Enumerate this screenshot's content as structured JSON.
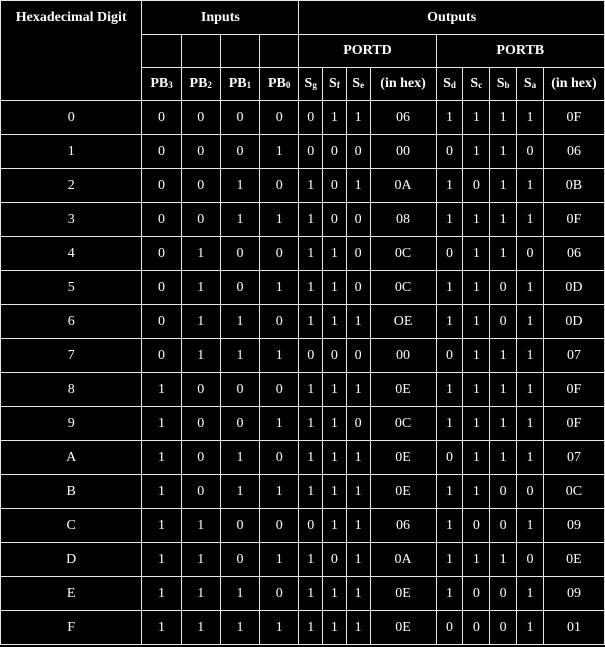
{
  "headers": {
    "hex_digit": "Hexadecimal Digit",
    "inputs": "Inputs",
    "outputs": "Outputs",
    "portd": "PORTD",
    "portb": "PORTB",
    "input_cols": [
      {
        "base": "PB",
        "sub": "3"
      },
      {
        "base": "PB",
        "sub": "2"
      },
      {
        "base": "PB",
        "sub": "1"
      },
      {
        "base": "PB",
        "sub": "0"
      }
    ],
    "portd_cols": [
      {
        "base": "S",
        "sub": "g"
      },
      {
        "base": "S",
        "sub": "f"
      },
      {
        "base": "S",
        "sub": "e"
      }
    ],
    "portd_hex": "(in hex)",
    "portb_cols": [
      {
        "base": "S",
        "sub": "d"
      },
      {
        "base": "S",
        "sub": "c"
      },
      {
        "base": "S",
        "sub": "b"
      },
      {
        "base": "S",
        "sub": "a"
      }
    ],
    "portb_hex": "(in hex)"
  },
  "rows": [
    {
      "digit": "0",
      "pb": [
        "0",
        "0",
        "0",
        "0"
      ],
      "d": [
        "0",
        "1",
        "1"
      ],
      "dhex": "06",
      "b": [
        "1",
        "1",
        "1",
        "1"
      ],
      "bhex": "0F"
    },
    {
      "digit": "1",
      "pb": [
        "0",
        "0",
        "0",
        "1"
      ],
      "d": [
        "0",
        "0",
        "0"
      ],
      "dhex": "00",
      "b": [
        "0",
        "1",
        "1",
        "0"
      ],
      "bhex": "06"
    },
    {
      "digit": "2",
      "pb": [
        "0",
        "0",
        "1",
        "0"
      ],
      "d": [
        "1",
        "0",
        "1"
      ],
      "dhex": "0A",
      "b": [
        "1",
        "0",
        "1",
        "1"
      ],
      "bhex": "0B"
    },
    {
      "digit": "3",
      "pb": [
        "0",
        "0",
        "1",
        "1"
      ],
      "d": [
        "1",
        "0",
        "0"
      ],
      "dhex": "08",
      "b": [
        "1",
        "1",
        "1",
        "1"
      ],
      "bhex": "0F"
    },
    {
      "digit": "4",
      "pb": [
        "0",
        "1",
        "0",
        "0"
      ],
      "d": [
        "1",
        "1",
        "0"
      ],
      "dhex": "0C",
      "b": [
        "0",
        "1",
        "1",
        "0"
      ],
      "bhex": "06"
    },
    {
      "digit": "5",
      "pb": [
        "0",
        "1",
        "0",
        "1"
      ],
      "d": [
        "1",
        "1",
        "0"
      ],
      "dhex": "0C",
      "b": [
        "1",
        "1",
        "0",
        "1"
      ],
      "bhex": "0D"
    },
    {
      "digit": "6",
      "pb": [
        "0",
        "1",
        "1",
        "0"
      ],
      "d": [
        "1",
        "1",
        "1"
      ],
      "dhex": "OE",
      "b": [
        "1",
        "1",
        "0",
        "1"
      ],
      "bhex": "0D"
    },
    {
      "digit": "7",
      "pb": [
        "0",
        "1",
        "1",
        "1"
      ],
      "d": [
        "0",
        "0",
        "0"
      ],
      "dhex": "00",
      "b": [
        "0",
        "1",
        "1",
        "1"
      ],
      "bhex": "07"
    },
    {
      "digit": "8",
      "pb": [
        "1",
        "0",
        "0",
        "0"
      ],
      "d": [
        "1",
        "1",
        "1"
      ],
      "dhex": "0E",
      "b": [
        "1",
        "1",
        "1",
        "1"
      ],
      "bhex": "0F"
    },
    {
      "digit": "9",
      "pb": [
        "1",
        "0",
        "0",
        "1"
      ],
      "d": [
        "1",
        "1",
        "0"
      ],
      "dhex": "0C",
      "b": [
        "1",
        "1",
        "1",
        "1"
      ],
      "bhex": "0F"
    },
    {
      "digit": "A",
      "pb": [
        "1",
        "0",
        "1",
        "0"
      ],
      "d": [
        "1",
        "1",
        "1"
      ],
      "dhex": "0E",
      "b": [
        "0",
        "1",
        "1",
        "1"
      ],
      "bhex": "07"
    },
    {
      "digit": "B",
      "pb": [
        "1",
        "0",
        "1",
        "1"
      ],
      "d": [
        "1",
        "1",
        "1"
      ],
      "dhex": "0E",
      "b": [
        "1",
        "1",
        "0",
        "0"
      ],
      "bhex": "0C"
    },
    {
      "digit": "C",
      "pb": [
        "1",
        "1",
        "0",
        "0"
      ],
      "d": [
        "0",
        "1",
        "1"
      ],
      "dhex": "06",
      "b": [
        "1",
        "0",
        "0",
        "1"
      ],
      "bhex": "09"
    },
    {
      "digit": "D",
      "pb": [
        "1",
        "1",
        "0",
        "1"
      ],
      "d": [
        "1",
        "0",
        "1"
      ],
      "dhex": "0A",
      "b": [
        "1",
        "1",
        "1",
        "0"
      ],
      "bhex": "0E"
    },
    {
      "digit": "E",
      "pb": [
        "1",
        "1",
        "1",
        "0"
      ],
      "d": [
        "1",
        "1",
        "1"
      ],
      "dhex": "0E",
      "b": [
        "1",
        "0",
        "0",
        "1"
      ],
      "bhex": "09"
    },
    {
      "digit": "F",
      "pb": [
        "1",
        "1",
        "1",
        "1"
      ],
      "d": [
        "1",
        "1",
        "1"
      ],
      "dhex": "0E",
      "b": [
        "0",
        "0",
        "0",
        "1"
      ],
      "bhex": "01"
    }
  ]
}
